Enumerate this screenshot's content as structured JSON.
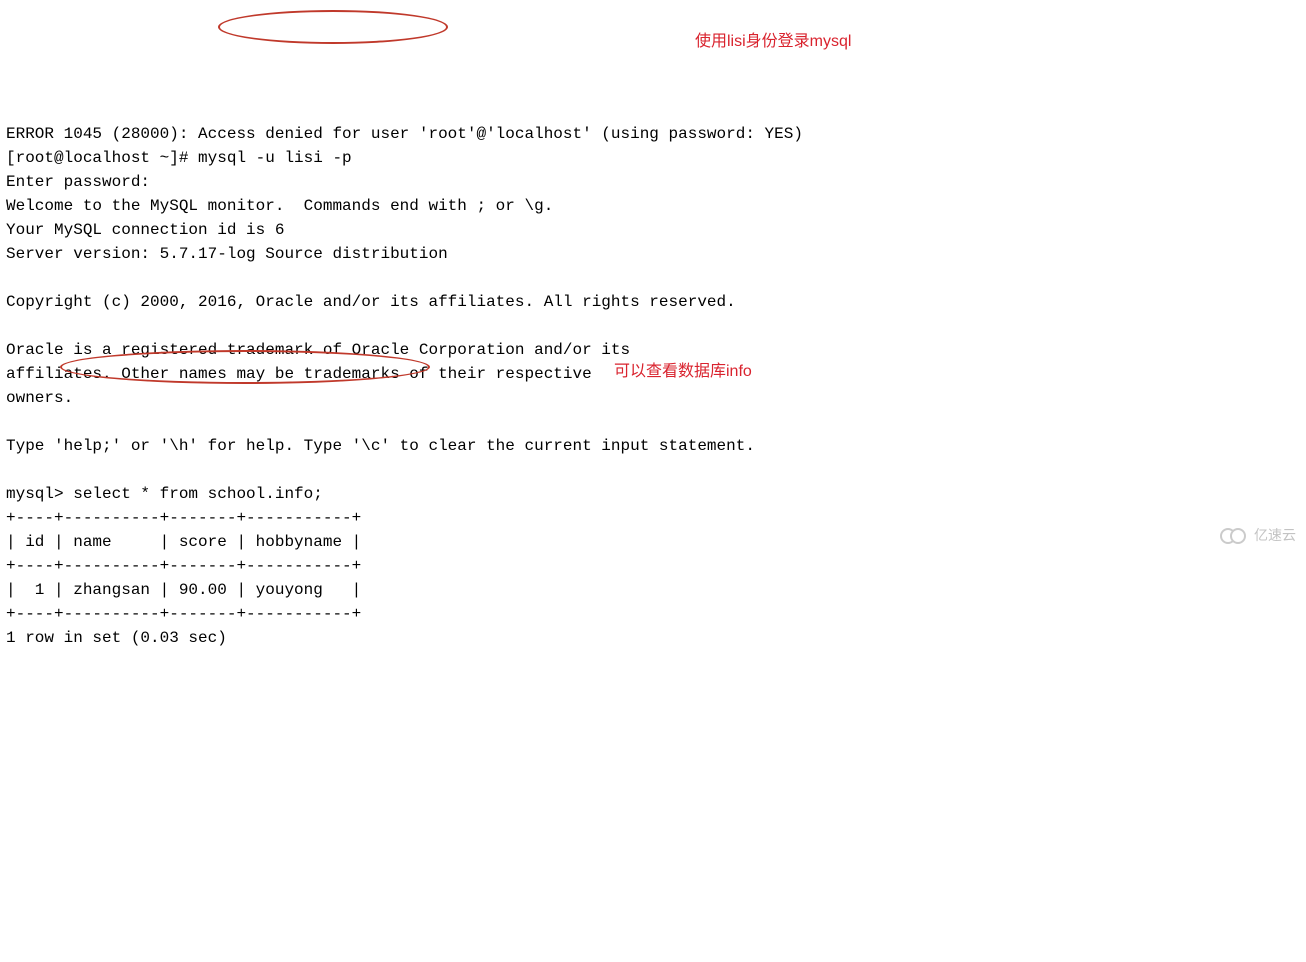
{
  "terminal": {
    "lines": [
      "ERROR 1045 (28000): Access denied for user 'root'@'localhost' (using password: YES)",
      "[root@localhost ~]# mysql -u lisi -p",
      "Enter password: ",
      "Welcome to the MySQL monitor.  Commands end with ; or \\g.",
      "Your MySQL connection id is 6",
      "Server version: 5.7.17-log Source distribution",
      "",
      "Copyright (c) 2000, 2016, Oracle and/or its affiliates. All rights reserved.",
      "",
      "Oracle is a registered trademark of Oracle Corporation and/or its",
      "affiliates. Other names may be trademarks of their respective",
      "owners.",
      "",
      "Type 'help;' or '\\h' for help. Type '\\c' to clear the current input statement.",
      "",
      "mysql> select * from school.info;",
      "+----+----------+-------+-----------+",
      "| id | name     | score | hobbyname |",
      "+----+----------+-------+-----------+",
      "|  1 | zhangsan | 90.00 | youyong   |",
      "+----+----------+-------+-----------+",
      "1 row in set (0.03 sec)"
    ]
  },
  "annotations": {
    "note1": "使用lisi身份登录mysql",
    "note2": "可以查看数据库info"
  },
  "watermark": {
    "text": "亿速云"
  },
  "chart_data": {
    "type": "table",
    "title": "school.info",
    "columns": [
      "id",
      "name",
      "score",
      "hobbyname"
    ],
    "rows": [
      {
        "id": 1,
        "name": "zhangsan",
        "score": 90.0,
        "hobbyname": "youyong"
      }
    ],
    "footer": "1 row in set (0.03 sec)"
  }
}
